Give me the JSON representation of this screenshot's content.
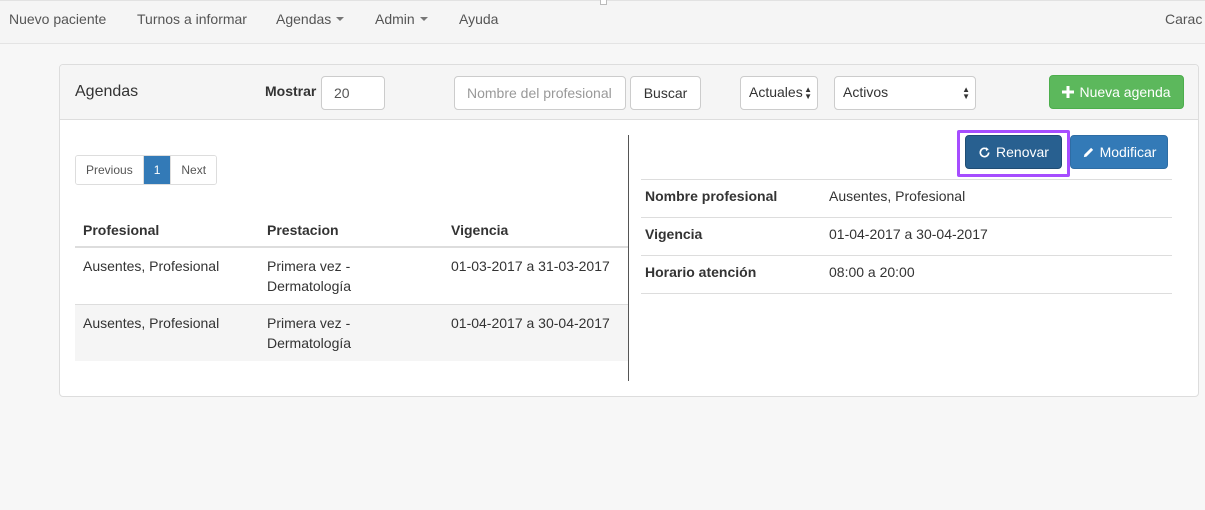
{
  "navbar": {
    "items": [
      {
        "label": "Nuevo paciente",
        "dropdown": false
      },
      {
        "label": "Turnos a informar",
        "dropdown": false
      },
      {
        "label": "Agendas",
        "dropdown": true
      },
      {
        "label": "Admin",
        "dropdown": true
      },
      {
        "label": "Ayuda",
        "dropdown": false
      }
    ],
    "right_label": "Carac"
  },
  "panel": {
    "title": "Agendas",
    "mostrar_label": "Mostrar",
    "mostrar_value": "20",
    "search_placeholder": "Nombre del profesional",
    "search_button": "Buscar",
    "filter_period": "Actuales",
    "filter_status": "Activos",
    "new_button": "Nueva agenda"
  },
  "pagination": {
    "previous": "Previous",
    "current_page": "1",
    "next": "Next"
  },
  "table": {
    "headers": [
      "Profesional",
      "Prestacion",
      "Vigencia"
    ],
    "rows": [
      {
        "profesional": "Ausentes, Profesional",
        "prestacion": "Primera vez - Dermatología",
        "vigencia": "01-03-2017 a 31-03-2017"
      },
      {
        "profesional": "Ausentes, Profesional",
        "prestacion": "Primera vez - Dermatología",
        "vigencia": "01-04-2017 a 30-04-2017"
      }
    ]
  },
  "detail": {
    "renew_button": "Renovar",
    "modify_button": "Modificar",
    "fields": [
      {
        "label": "Nombre profesional",
        "value": "Ausentes, Profesional"
      },
      {
        "label": "Vigencia",
        "value": "01-04-2017 a 30-04-2017"
      },
      {
        "label": "Horario atención",
        "value": "08:00 a 20:00"
      }
    ]
  },
  "colors": {
    "primary": "#337ab7",
    "primary_dark": "#286090",
    "success": "#5cb85c",
    "highlight": "#a64dff"
  },
  "icons": {
    "new_agenda": "plus-icon",
    "renew": "refresh-icon",
    "modify": "pencil-icon",
    "dropdown": "caret-down-icon",
    "select": "select-arrows-icon"
  }
}
